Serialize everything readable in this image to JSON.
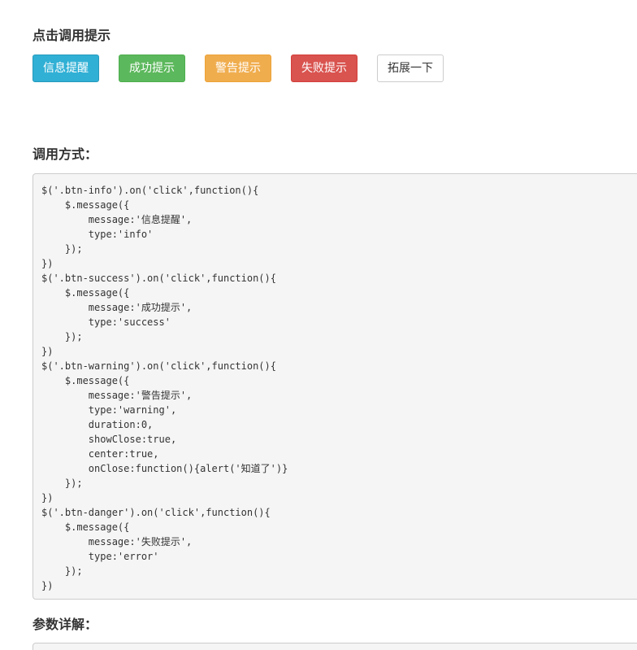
{
  "demo": {
    "title": "点击调用提示",
    "buttons": {
      "info": "信息提醒",
      "success": "成功提示",
      "warning": "警告提示",
      "danger": "失败提示",
      "extend": "拓展一下"
    }
  },
  "usage": {
    "title": "调用方式：",
    "code_lines": [
      "$('.btn-info').on('click',function(){",
      "    $.message({",
      "        message:'信息提醒',",
      "        type:'info'",
      "    });",
      "})",
      "$('.btn-success').on('click',function(){",
      "    $.message({",
      "        message:'成功提示',",
      "        type:'success'",
      "    });",
      "})",
      "$('.btn-warning').on('click',function(){",
      "    $.message({",
      "        message:'警告提示',",
      "        type:'warning',",
      "        duration:0,",
      "        showClose:true,",
      "        center:true,",
      "        onClose:function(){alert('知道了')}",
      "    });",
      "})",
      "$('.btn-danger').on('click',function(){",
      "    $.message({",
      "        message:'失败提示',",
      "        type:'error'",
      "    });",
      "})"
    ]
  },
  "params": {
    "title": "参数详解："
  },
  "colors": {
    "info": "#31b0d5",
    "success": "#5cb85c",
    "warning": "#f0ad4e",
    "danger": "#d9534f",
    "code_bg": "#f5f5f5"
  }
}
